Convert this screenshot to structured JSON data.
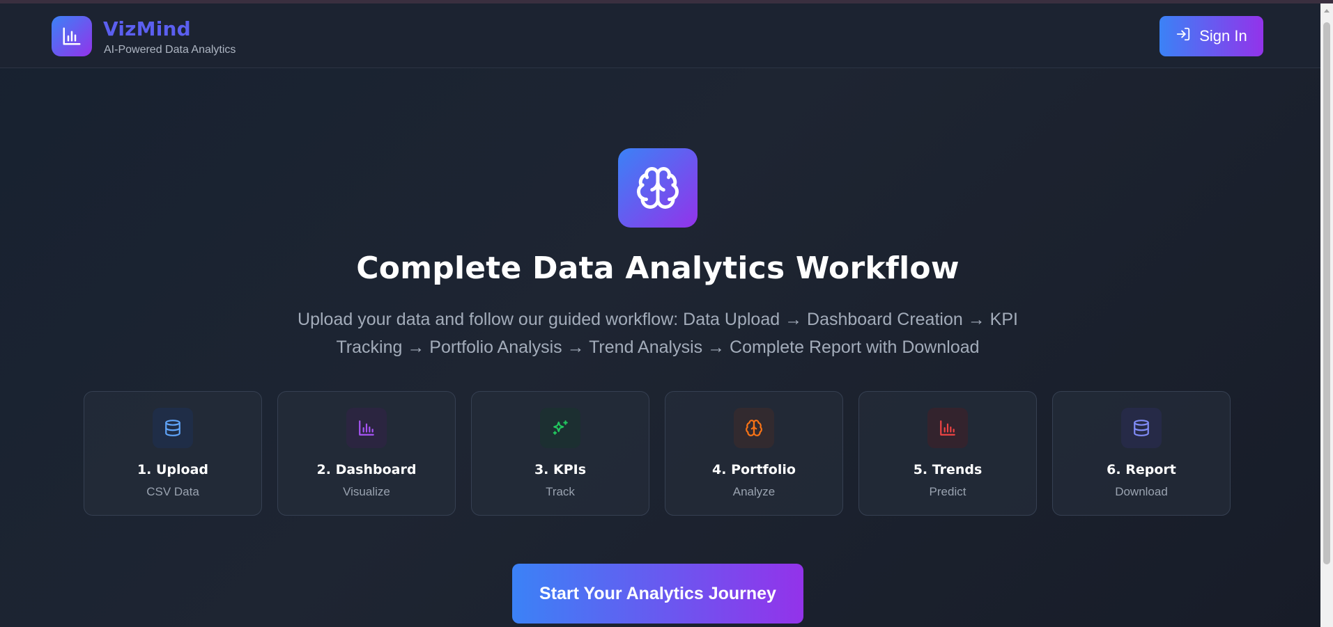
{
  "header": {
    "brand": "VizMind",
    "tagline": "AI-Powered Data Analytics",
    "signin_label": "Sign In"
  },
  "hero": {
    "title": "Complete Data Analytics Workflow",
    "subtitle": "Upload your data and follow our guided workflow: Data Upload → Dashboard Creation → KPI Tracking → Portfolio Analysis → Trend Analysis → Complete Report with Download"
  },
  "steps": [
    {
      "title": "1. Upload",
      "subtitle": "CSV Data",
      "icon": "database-icon",
      "color": "#60a5fa",
      "bg": "#1f2d47"
    },
    {
      "title": "2. Dashboard",
      "subtitle": "Visualize",
      "icon": "bar-chart-icon",
      "color": "#a855f7",
      "bg": "#2b2540"
    },
    {
      "title": "3. KPIs",
      "subtitle": "Track",
      "icon": "sparkles-icon",
      "color": "#22c55e",
      "bg": "#1c2f31"
    },
    {
      "title": "4. Portfolio",
      "subtitle": "Analyze",
      "icon": "brain-icon",
      "color": "#f97316",
      "bg": "#322a2f"
    },
    {
      "title": "5. Trends",
      "subtitle": "Predict",
      "icon": "bar-chart-icon",
      "color": "#ef4444",
      "bg": "#33232d"
    },
    {
      "title": "6. Report",
      "subtitle": "Download",
      "icon": "database-icon",
      "color": "#818cf8",
      "bg": "#262a47"
    }
  ],
  "cta": {
    "label": "Start Your Analytics Journey"
  }
}
